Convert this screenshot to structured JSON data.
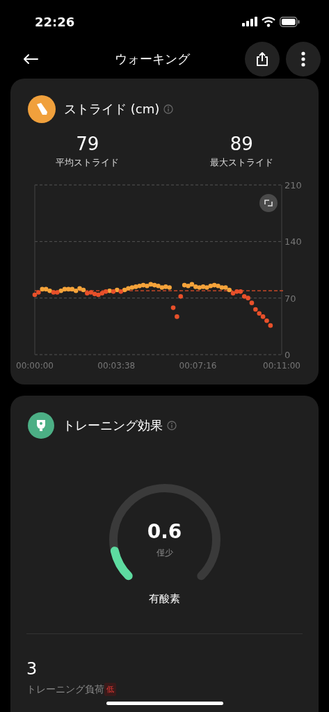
{
  "status_bar": {
    "time": "22:26"
  },
  "nav": {
    "title": "ウォーキング"
  },
  "stride_card": {
    "title": "ストライド (cm)",
    "stats": [
      {
        "value": "79",
        "label": "平均ストライド"
      },
      {
        "value": "89",
        "label": "最大ストライド"
      }
    ],
    "chart_data": {
      "type": "scatter",
      "x": [
        0,
        10,
        20,
        30,
        40,
        50,
        60,
        70,
        80,
        90,
        100,
        110,
        120,
        130,
        140,
        150,
        160,
        170,
        180,
        190,
        200,
        210,
        220,
        230,
        240,
        250,
        260,
        270,
        280,
        290,
        300,
        310,
        320,
        330,
        340,
        350,
        360,
        370,
        380,
        390,
        400,
        410,
        420,
        430,
        440,
        450,
        460,
        470,
        480,
        490,
        500,
        510,
        520,
        530,
        540,
        550,
        560,
        570,
        580,
        590,
        600,
        610,
        620,
        630
      ],
      "series": [
        {
          "color": "#f5a33a",
          "values": [
            null,
            null,
            81,
            81,
            79,
            null,
            null,
            79,
            81,
            81,
            81,
            79,
            82,
            80,
            null,
            null,
            null,
            null,
            null,
            null,
            79,
            null,
            80,
            null,
            80,
            82,
            83,
            84,
            85,
            86,
            85,
            87,
            86,
            85,
            83,
            84,
            83,
            null,
            null,
            null,
            86,
            85,
            87,
            84,
            83,
            84,
            83,
            85,
            86,
            85,
            83,
            83,
            80,
            null,
            null,
            null,
            null,
            null,
            null,
            null,
            null,
            null,
            null,
            null
          ]
        },
        {
          "color": "#e8502a",
          "values": [
            74,
            77,
            null,
            null,
            null,
            77,
            77,
            null,
            null,
            null,
            null,
            null,
            null,
            null,
            76,
            77,
            75,
            74,
            76,
            78,
            null,
            78,
            null,
            78,
            null,
            null,
            null,
            null,
            null,
            null,
            null,
            null,
            null,
            null,
            null,
            null,
            null,
            58,
            47,
            72,
            null,
            null,
            null,
            null,
            null,
            null,
            null,
            null,
            null,
            null,
            null,
            null,
            null,
            76,
            78,
            78,
            72,
            70,
            64,
            56,
            51,
            47,
            42,
            36
          ]
        }
      ],
      "xlim": [
        0,
        660
      ],
      "ylim": [
        0,
        210
      ],
      "xticks": [
        {
          "value": 0,
          "label": "00:00:00"
        },
        {
          "value": 218,
          "label": "00:03:38"
        },
        {
          "value": 436,
          "label": "00:07:16"
        },
        {
          "value": 660,
          "label": "00:11:00"
        }
      ],
      "yticks": [
        0,
        70,
        140,
        210
      ],
      "ref_lines": [
        {
          "axis": "y",
          "value": 79,
          "color": "#e8502a"
        }
      ]
    }
  },
  "effect_card": {
    "title": "トレーニング効果",
    "gauge": {
      "value": "0.6",
      "grade": "僅少",
      "type": "有酸素"
    },
    "load": {
      "value": "3",
      "label": "トレーニング負荷",
      "badge": "低"
    }
  }
}
